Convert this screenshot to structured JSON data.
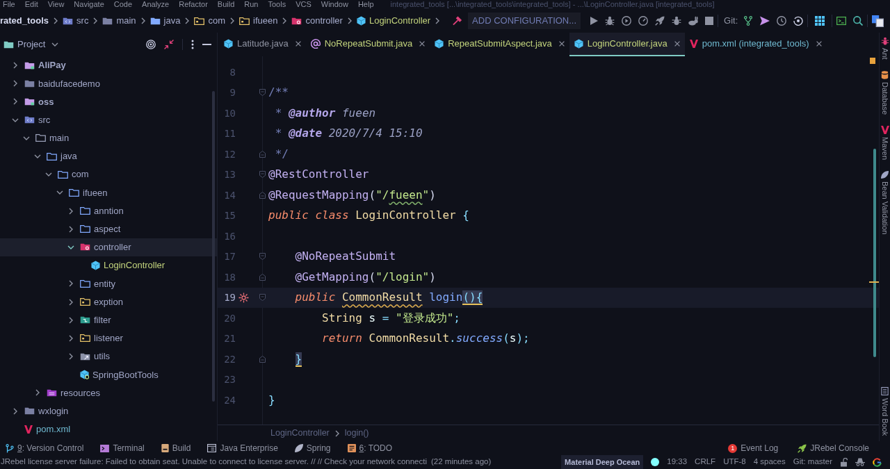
{
  "menu_bar": {
    "items": [
      "File",
      "Edit",
      "View",
      "Navigate",
      "Code",
      "Analyze",
      "Refactor",
      "Build",
      "Run",
      "Tools",
      "VCS",
      "Window",
      "Help"
    ],
    "title": "integrated_tools [...\\integrated_tools\\integrated_tools] - ...\\LoginController.java [integrated_tools]"
  },
  "nav_bar": {
    "breadcrumbs": [
      {
        "label": "rated_tools",
        "kind": "project"
      },
      {
        "label": "src",
        "kind": "source-root"
      },
      {
        "label": "main",
        "kind": "folder"
      },
      {
        "label": "java",
        "kind": "source-folder"
      },
      {
        "label": "com",
        "kind": "special-package"
      },
      {
        "label": "ifueen",
        "kind": "special-package"
      },
      {
        "label": "controller",
        "kind": "controller-package"
      },
      {
        "label": "LoginController",
        "kind": "class"
      }
    ],
    "run_config": "ADD CONFIGURATION...",
    "git_label": "Git:"
  },
  "project_panel": {
    "title": "Project",
    "tree": [
      {
        "label": "AliPay",
        "kind": "module",
        "color": "#a0a6c6",
        "expanded": false,
        "selected": false
      },
      {
        "label": "baidufacedemo",
        "kind": "folder",
        "color": "#a0a6c6",
        "expanded": false,
        "selected": false
      },
      {
        "label": "oss",
        "kind": "module",
        "color": "#a0a6c6",
        "expanded": false,
        "selected": false
      },
      {
        "label": "src",
        "kind": "source-root",
        "color": "#a0a6c6",
        "expanded": true,
        "selected": false,
        "children": [
          {
            "label": "main",
            "kind": "dir",
            "color": "#a0a6c6",
            "expanded": true,
            "selected": false,
            "children": [
              {
                "label": "java",
                "kind": "package",
                "color": "#a0a6c6",
                "expanded": true,
                "selected": false,
                "children": [
                  {
                    "label": "com",
                    "kind": "package",
                    "color": "#a0a6c6",
                    "expanded": true,
                    "selected": false,
                    "children": [
                      {
                        "label": "ifueen",
                        "kind": "package",
                        "color": "#a0a6c6",
                        "expanded": true,
                        "selected": false,
                        "children": [
                          {
                            "label": "anntion",
                            "kind": "package",
                            "color": "#a0a6c6",
                            "expanded": false,
                            "selected": false
                          },
                          {
                            "label": "aspect",
                            "kind": "package",
                            "color": "#a0a6c6",
                            "expanded": false,
                            "selected": false
                          },
                          {
                            "label": "controller",
                            "kind": "controller-package",
                            "color": "#a0a6c6",
                            "expanded": true,
                            "selected": true,
                            "children": [
                              {
                                "label": "LoginController",
                                "kind": "class",
                                "color": "#c3d47d",
                                "selected": false
                              }
                            ]
                          },
                          {
                            "label": "entity",
                            "kind": "package",
                            "color": "#a0a6c6",
                            "expanded": false,
                            "selected": false
                          },
                          {
                            "label": "exption",
                            "kind": "special-package",
                            "color": "#a0a6c6",
                            "expanded": false,
                            "selected": false
                          },
                          {
                            "label": "filter",
                            "kind": "filter-package",
                            "color": "#a0a6c6",
                            "expanded": false,
                            "selected": false
                          },
                          {
                            "label": "listener",
                            "kind": "special-package",
                            "color": "#a0a6c6",
                            "expanded": false,
                            "selected": false
                          },
                          {
                            "label": "utils",
                            "kind": "utils-package",
                            "color": "#a0a6c6",
                            "expanded": false,
                            "selected": false
                          },
                          {
                            "label": "SpringBootTools",
                            "kind": "boot-class",
                            "color": "#a0a6c6",
                            "selected": false
                          }
                        ]
                      }
                    ]
                  }
                ]
              },
              {
                "label": "resources",
                "kind": "resources",
                "color": "#a0a6c6",
                "expanded": false,
                "selected": false
              }
            ]
          }
        ]
      },
      {
        "label": "wxlogin",
        "kind": "folder",
        "color": "#a0a6c6",
        "expanded": false,
        "selected": false
      },
      {
        "label": "pom.xml",
        "kind": "maven",
        "color": "#6fb8cf",
        "selected": false
      }
    ]
  },
  "tabs": [
    {
      "label": "Latitude.java",
      "kind": "class",
      "color": "#8f93a2",
      "selected": false
    },
    {
      "label": "NoRepeatSubmit.java",
      "kind": "annotation",
      "color": "#c3d47d",
      "selected": false
    },
    {
      "label": "RepeatSubmitAspect.java",
      "kind": "class",
      "color": "#c3d47d",
      "selected": false
    },
    {
      "label": "LoginController.java",
      "kind": "class",
      "color": "#c3d47d",
      "selected": true
    },
    {
      "label": "pom.xml (integrated_tools)",
      "kind": "maven",
      "color": "#6fb8cf",
      "selected": false
    }
  ],
  "editor": {
    "lines": [
      {
        "number": "8",
        "current": false
      },
      {
        "number": "9",
        "current": false,
        "fold_start": true,
        "tokens": [
          {
            "text": "/**",
            "kind": "comment"
          }
        ]
      },
      {
        "number": "10",
        "current": false,
        "tokens": [
          {
            "text": " * ",
            "kind": "comment"
          },
          {
            "text": "@author",
            "kind": "doc-tag"
          },
          {
            "text": " fueen",
            "kind": "doc-value"
          }
        ]
      },
      {
        "number": "11",
        "current": false,
        "tokens": [
          {
            "text": " * ",
            "kind": "comment"
          },
          {
            "text": "@date",
            "kind": "doc-tag"
          },
          {
            "text": " 2020/7/4 15:10",
            "kind": "doc-value"
          }
        ]
      },
      {
        "number": "12",
        "current": false,
        "fold_end": true,
        "tokens": [
          {
            "text": " */",
            "kind": "comment"
          }
        ]
      },
      {
        "number": "13",
        "current": false,
        "fold_start": true,
        "tokens": [
          {
            "text": "@RestController",
            "kind": "annotation"
          }
        ]
      },
      {
        "number": "14",
        "current": false,
        "fold_end": true,
        "tokens": [
          {
            "text": "@RequestMapping",
            "kind": "annotation"
          },
          {
            "text": "(",
            "kind": "paren"
          },
          {
            "text": "\"/",
            "kind": "string"
          },
          {
            "text": "fueen",
            "kind": "typo-string"
          },
          {
            "text": "\"",
            "kind": "string"
          },
          {
            "text": ")",
            "kind": "paren"
          }
        ]
      },
      {
        "number": "15",
        "current": false,
        "tokens": [
          {
            "text": "public ",
            "kind": "keyword"
          },
          {
            "text": "class ",
            "kind": "keyword"
          },
          {
            "text": "LoginController ",
            "kind": "class-name"
          },
          {
            "text": "{",
            "kind": "punct"
          }
        ]
      },
      {
        "number": "16",
        "current": false
      },
      {
        "number": "17",
        "current": false,
        "fold_start": true,
        "tokens": [
          {
            "text": "    @NoRepeatSubmit",
            "kind": "annotation"
          }
        ]
      },
      {
        "number": "18",
        "current": false,
        "fold_end": true,
        "tokens": [
          {
            "text": "    @GetMapping",
            "kind": "annotation"
          },
          {
            "text": "(",
            "kind": "paren"
          },
          {
            "text": "\"/login\"",
            "kind": "string"
          },
          {
            "text": ")",
            "kind": "paren"
          }
        ]
      },
      {
        "number": "19",
        "current": true,
        "fold_start": true,
        "gutter_icon": true,
        "tokens": [
          {
            "text": "    public ",
            "kind": "keyword"
          },
          {
            "text": "CommonResult",
            "kind": "warn-type"
          },
          {
            "text": " login",
            "kind": "method"
          },
          {
            "text": "(){",
            "kind": "brace-match"
          }
        ]
      },
      {
        "number": "20",
        "current": false,
        "tokens": [
          {
            "text": "        String ",
            "kind": "type"
          },
          {
            "text": "s ",
            "kind": "plain"
          },
          {
            "text": "= ",
            "kind": "punct"
          },
          {
            "text": "\"登录成功\"",
            "kind": "string"
          },
          {
            "text": ";",
            "kind": "punct"
          }
        ]
      },
      {
        "number": "21",
        "current": false,
        "tokens": [
          {
            "text": "        return ",
            "kind": "keyword"
          },
          {
            "text": "CommonResult",
            "kind": "type"
          },
          {
            "text": ".",
            "kind": "punct"
          },
          {
            "text": "success",
            "kind": "static-method"
          },
          {
            "text": "(",
            "kind": "punct"
          },
          {
            "text": "s",
            "kind": "plain"
          },
          {
            "text": ");",
            "kind": "punct"
          }
        ]
      },
      {
        "number": "22",
        "current": false,
        "fold_end": true,
        "tokens": [
          {
            "text": "    }",
            "kind": "brace-match"
          }
        ]
      },
      {
        "number": "23",
        "current": false
      },
      {
        "number": "24",
        "current": false,
        "tokens": [
          {
            "text": "}",
            "kind": "punct"
          }
        ]
      }
    ],
    "breadcrumbs": [
      "LoginController",
      "login()"
    ]
  },
  "side_stripe": [
    {
      "label": "Ant",
      "kind": "ant"
    },
    {
      "label": "Database",
      "kind": "database"
    },
    {
      "label": "Maven",
      "kind": "maven"
    },
    {
      "label": "Bean Validation",
      "kind": "bean-validation"
    },
    {
      "label": "Word Book",
      "kind": "word-book"
    }
  ],
  "tool_window_bar": {
    "left": [
      {
        "mnemonic": "9",
        "label": ": Version Control",
        "kind": "vcs"
      },
      {
        "label": "Terminal",
        "kind": "terminal"
      },
      {
        "label": "Build",
        "kind": "build"
      },
      {
        "label": "Java Enterprise",
        "kind": "java-ee"
      },
      {
        "label": "Spring",
        "kind": "spring"
      },
      {
        "mnemonic": "6",
        "label": ": TODO",
        "kind": "todo"
      }
    ],
    "right": [
      {
        "label": "Event Log",
        "badge": "1",
        "kind": "event-log"
      },
      {
        "label": "JRebel Console",
        "kind": "jrebel"
      }
    ]
  },
  "status_bar": {
    "message": "JRebel license server failure: Failed to obtain seat. Unable to connect to license server. // // Check your network connecti",
    "time_ago": "(22 minutes ago)",
    "theme": "Material Deep Ocean",
    "position": "19:33",
    "line_separator": "CRLF",
    "encoding": "UTF-8",
    "indent": "4 spaces",
    "branch": "Git: master"
  }
}
